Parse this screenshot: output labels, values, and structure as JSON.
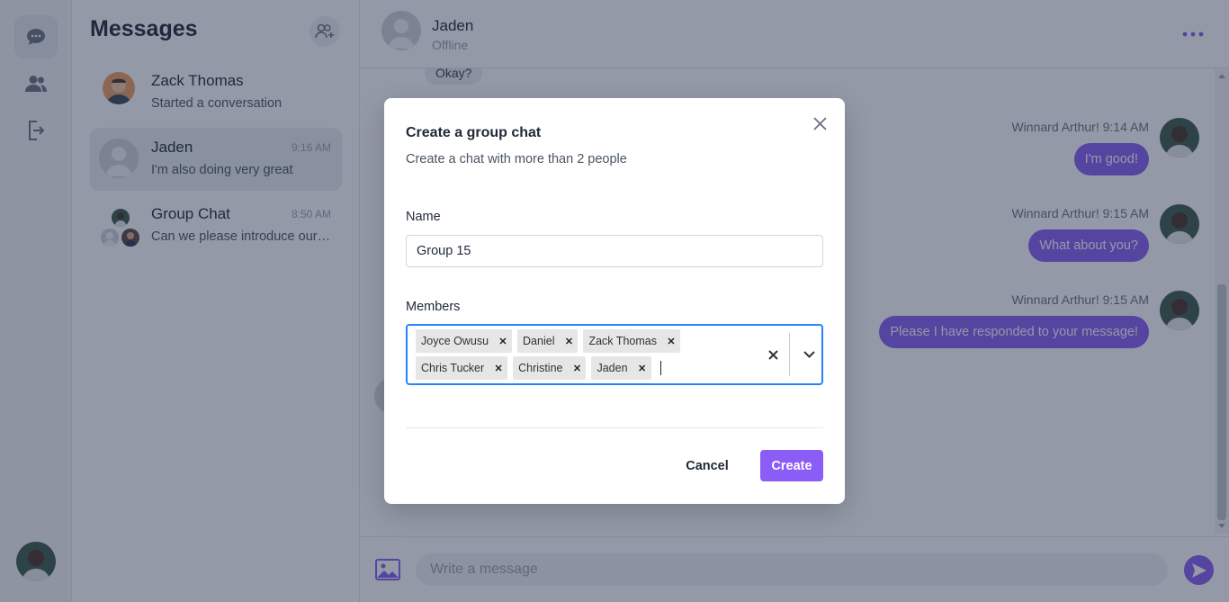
{
  "sidebar": {
    "items": [
      {
        "icon": "chat-bubble-icon",
        "active": true
      },
      {
        "icon": "users-icon",
        "active": false
      },
      {
        "icon": "logout-icon",
        "active": false
      }
    ]
  },
  "list": {
    "title": "Messages",
    "conversations": [
      {
        "name": "Zack Thomas",
        "preview": "Started a conversation",
        "time": ""
      },
      {
        "name": "Jaden",
        "preview": "I'm also doing very great",
        "time": "9:16 AM"
      },
      {
        "name": "Group Chat",
        "preview": "Can we please introduce ourselves",
        "time": "8:50 AM"
      }
    ]
  },
  "chat": {
    "contact_name": "Jaden",
    "contact_status": "Offline",
    "messages": [
      {
        "direction": "in",
        "text": "Okay?"
      },
      {
        "direction": "out",
        "sender": "Winnard Arthur!",
        "time": "9:14 AM",
        "text": "I'm good!"
      },
      {
        "direction": "out",
        "sender": "Winnard Arthur!",
        "time": "9:15 AM",
        "text": "What about you?"
      },
      {
        "direction": "out",
        "sender": "Winnard Arthur!",
        "time": "9:15 AM",
        "text": "Please I have responded to your message!"
      }
    ],
    "input_placeholder": "Write a message"
  },
  "modal": {
    "title": "Create a group chat",
    "subtitle": "Create a chat with more than 2 people",
    "name_label": "Name",
    "name_value": "Group 15",
    "members_label": "Members",
    "members": [
      "Joyce Owusu",
      "Daniel",
      "Zack Thomas",
      "Chris Tucker",
      "Christine",
      "Jaden"
    ],
    "cancel_label": "Cancel",
    "create_label": "Create"
  },
  "colors": {
    "accent": "#8b5cf6",
    "focus_border": "#2684ff",
    "overlay": "#1e2946"
  }
}
